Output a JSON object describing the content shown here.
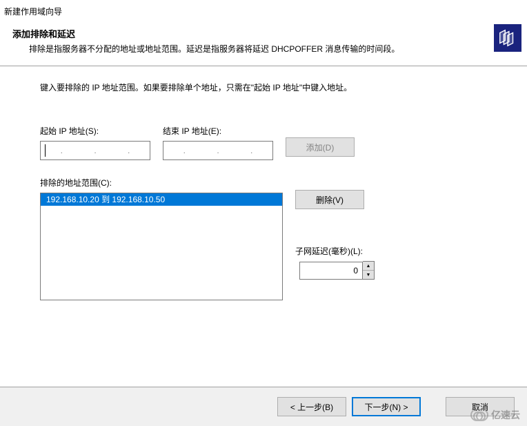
{
  "window": {
    "title": "新建作用域向导"
  },
  "header": {
    "title": "添加排除和延迟",
    "description": "排除是指服务器不分配的地址或地址范围。延迟是指服务器将延迟 DHCPOFFER 消息传输的时间段。"
  },
  "content": {
    "instruction": "键入要排除的 IP 地址范围。如果要排除单个地址，只需在\"起始 IP 地址\"中键入地址。"
  },
  "start_ip": {
    "label": "起始 IP 地址(S):",
    "value": ""
  },
  "end_ip": {
    "label": "结束 IP 地址(E):",
    "value": ""
  },
  "buttons": {
    "add": "添加(D)",
    "remove": "删除(V)",
    "back": "< 上一步(B)",
    "next": "下一步(N) >",
    "cancel": "取消"
  },
  "excluded": {
    "label": "排除的地址范围(C):",
    "items": [
      "192.168.10.20 到 192.168.10.50"
    ]
  },
  "delay": {
    "label": "子网延迟(毫秒)(L):",
    "value": "0"
  },
  "watermark": {
    "text": "亿速云"
  }
}
